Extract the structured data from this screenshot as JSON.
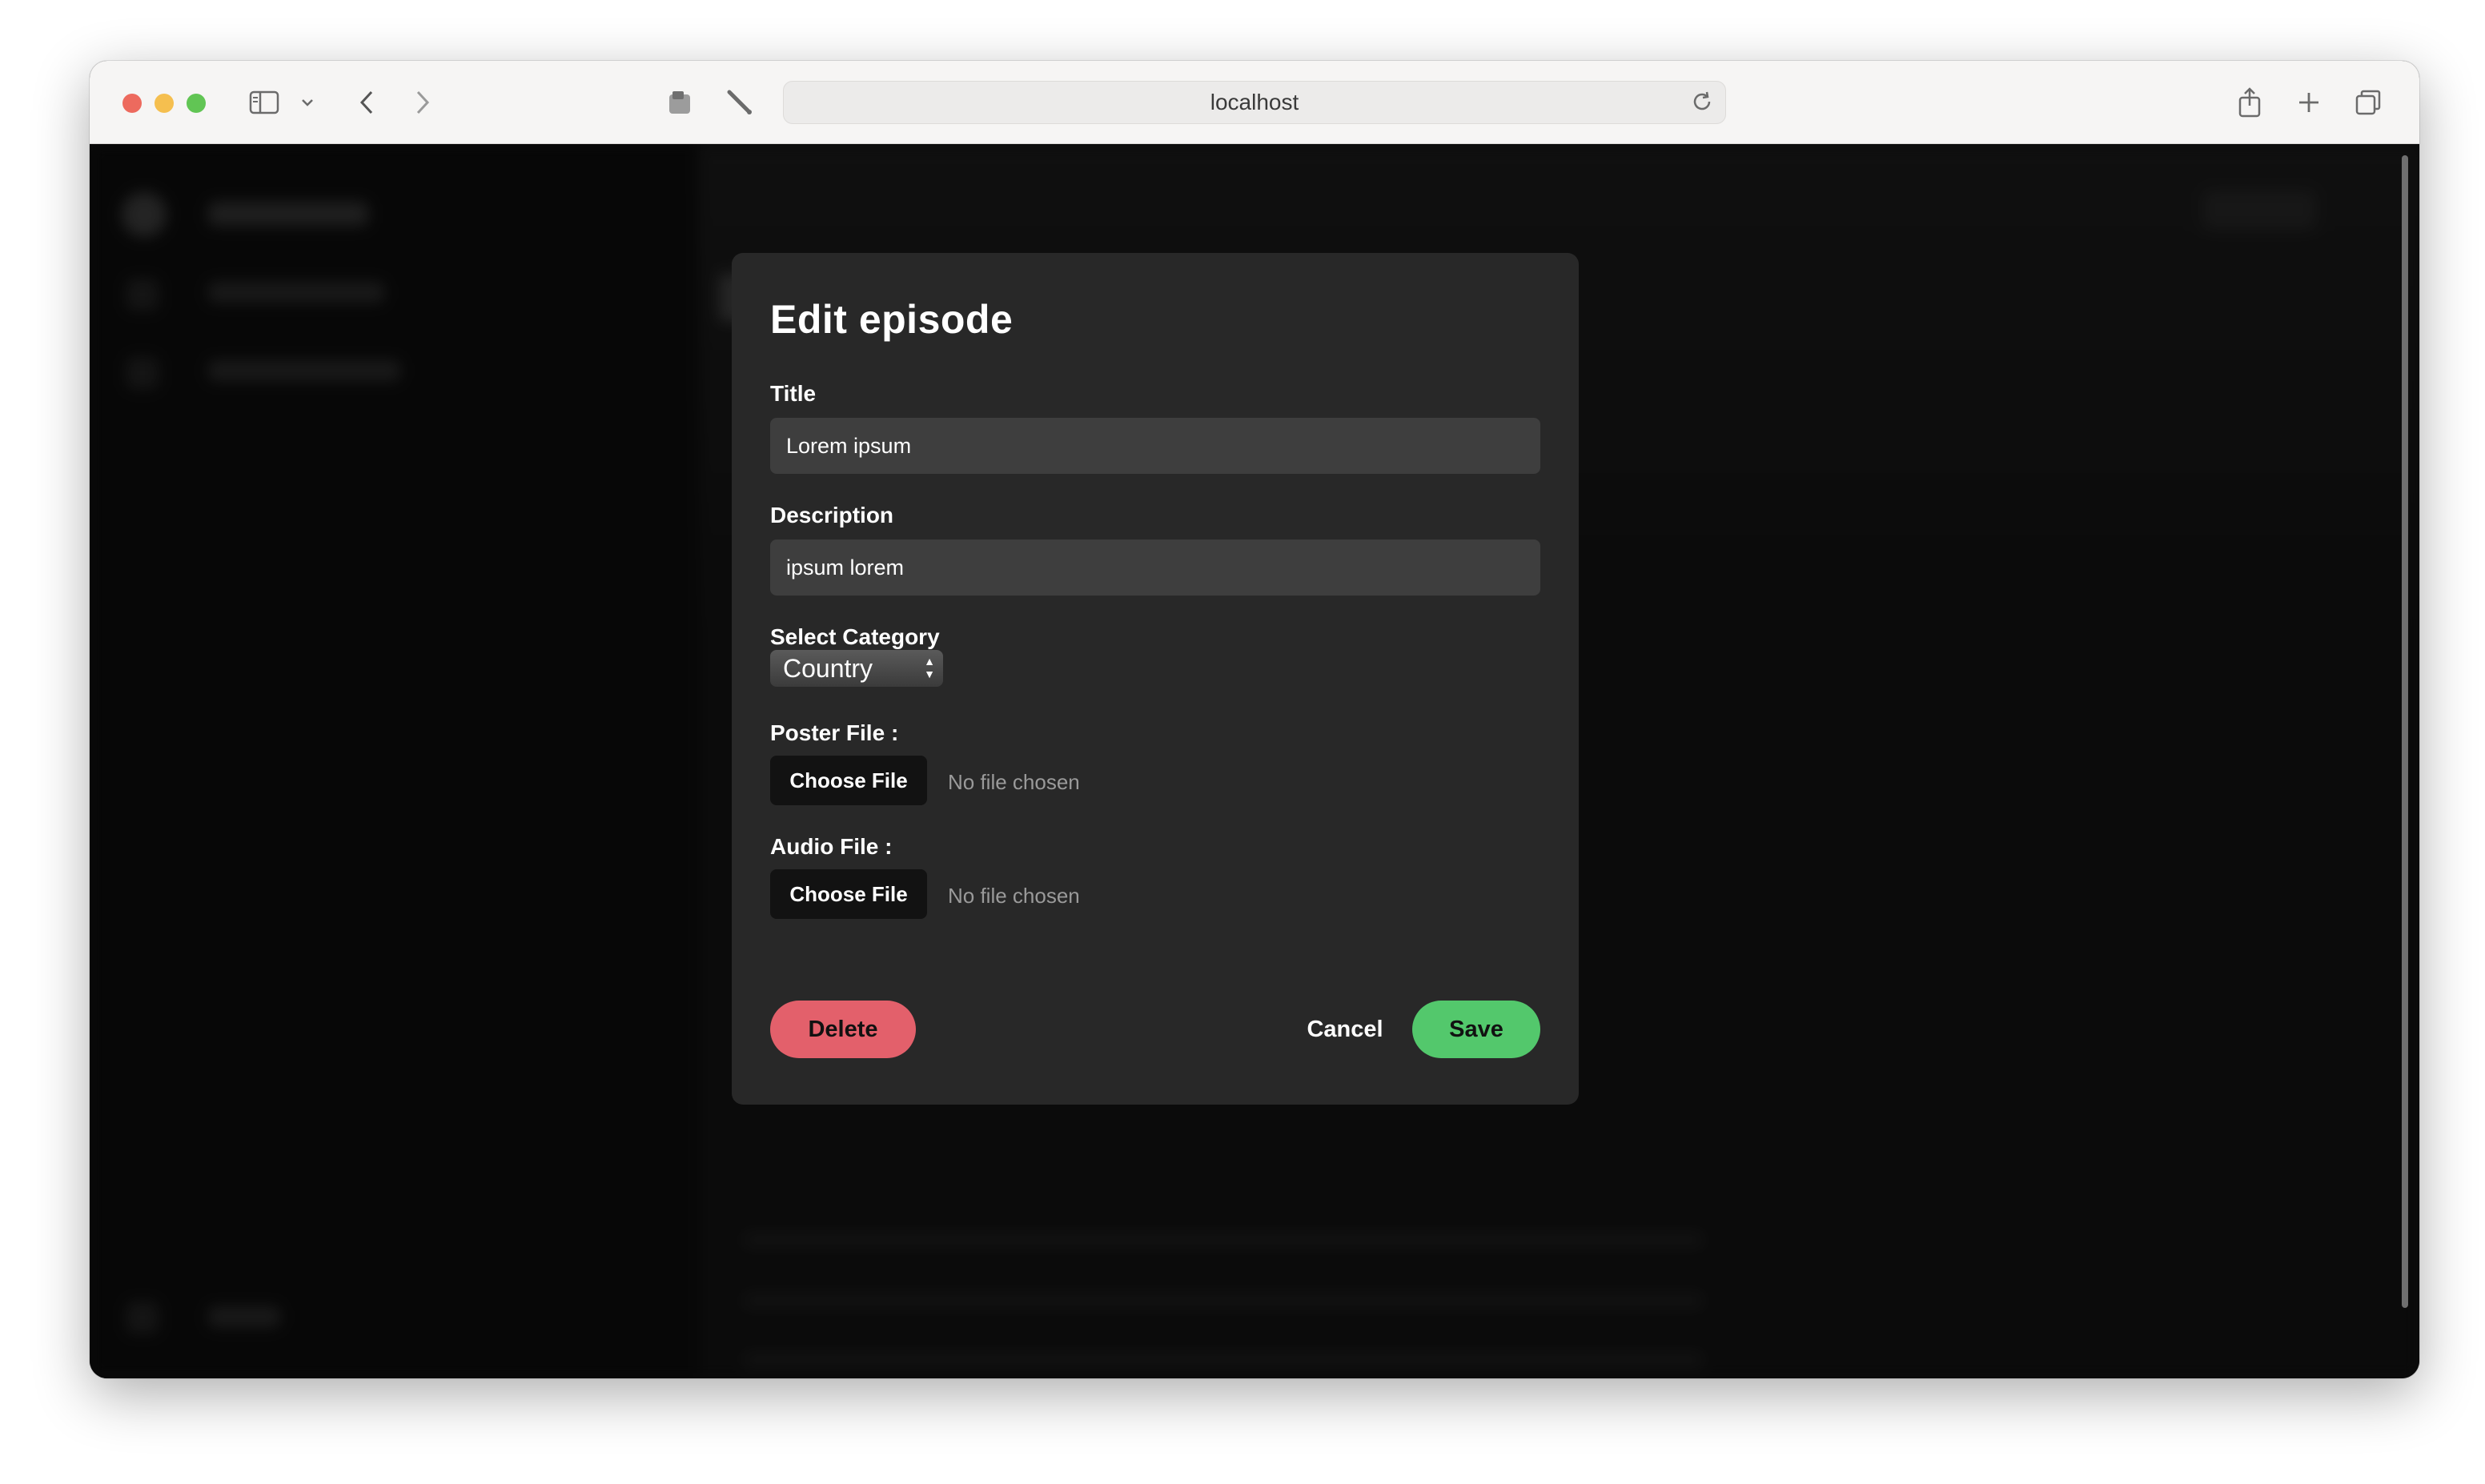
{
  "browser": {
    "address": "localhost"
  },
  "modal": {
    "title": "Edit episode",
    "title_label": "Title",
    "title_value": "Lorem ipsum",
    "description_label": "Description",
    "description_value": "ipsum lorem",
    "category_label": "Select Category",
    "category_value": "Country",
    "poster_label": "Poster File :",
    "poster_button": "Choose File",
    "poster_status": "No file chosen",
    "audio_label": "Audio File :",
    "audio_button": "Choose File",
    "audio_status": "No file chosen",
    "delete_label": "Delete",
    "cancel_label": "Cancel",
    "save_label": "Save"
  },
  "colors": {
    "delete": "#e3606b",
    "save": "#53c86c",
    "modal_bg": "#282828"
  },
  "icons": [
    "sidebar-toggle-icon",
    "chevron-down-icon",
    "back-icon",
    "forward-icon",
    "extension-icon",
    "pen-icon",
    "reload-icon",
    "share-icon",
    "new-tab-icon",
    "tabs-overview-icon"
  ]
}
